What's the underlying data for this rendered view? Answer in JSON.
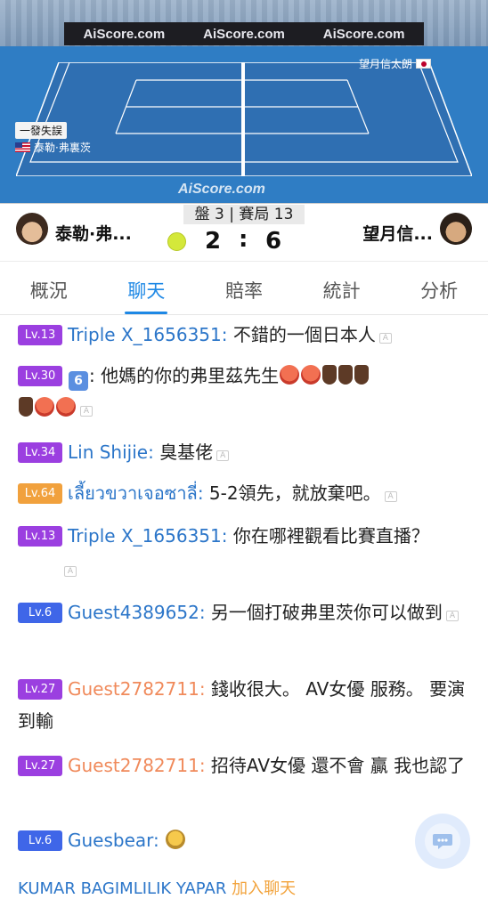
{
  "banner": {
    "brand1": "AiScore.com",
    "brand2": "AiScore.com",
    "brand3": "AiScore.com"
  },
  "watermark": "AiScore.com",
  "court": {
    "serve_tag": "一發失誤",
    "left_player": "泰勒·弗裏茨",
    "right_player": "望月信太朗"
  },
  "score": {
    "header": "盤 3 | 賽局 13",
    "left_name": "泰勒·弗...",
    "right_name": "望月信...",
    "left_score": "2",
    "colon": ":",
    "right_score": "6"
  },
  "tabs": [
    "概況",
    "聊天",
    "賠率",
    "統計",
    "分析"
  ],
  "chat": [
    {
      "level": "Lv.13",
      "user": "Triple X_1656351",
      "text": "不錯的一個日本人"
    },
    {
      "level": "Lv.30",
      "user": "6",
      "text": "他媽的你的弗里茲先生"
    },
    {
      "level": "Lv.34",
      "user": "Lin Shijie",
      "text": "臭基佬"
    },
    {
      "level": "Lv.64",
      "user": "เลี้ยวขวาเจอซาลี่",
      "text": "5-2領先，就放棄吧。"
    },
    {
      "level": "Lv.13",
      "user": "Triple X_1656351",
      "text": "你在哪裡觀看比賽直播？"
    },
    {
      "level": "Lv.6",
      "user": "Guest4389652",
      "text": "另一個打破弗里茨你可以做到"
    },
    {
      "level": "Lv.27",
      "user": "Guest2782711",
      "text": "錢收很大。 AV女優 服務。 要演到輸"
    },
    {
      "level": "Lv.27",
      "user": "Guest2782711",
      "text": "招待AV女優 還不會 贏 我也認了"
    },
    {
      "level": "Lv.6",
      "user": "Guesbear",
      "text": ""
    }
  ],
  "bottom": {
    "user": "KUMAR BAGIMLILIK YAPAR",
    "action": "加入聊天"
  },
  "icons": {
    "translate": "A",
    "chat_fab": "chat-bubble-icon"
  }
}
